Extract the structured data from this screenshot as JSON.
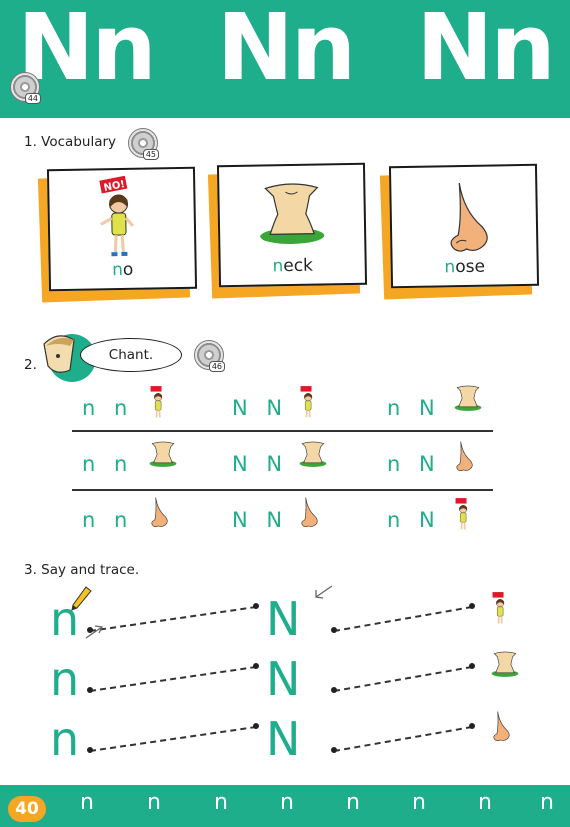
{
  "header": {
    "title": "Nn Nn Nn",
    "track": "44"
  },
  "vocabulary": {
    "title": "1. Vocabulary",
    "track": "45",
    "cards": [
      {
        "first": "n",
        "rest": "o",
        "icon": "girl-no-icon"
      },
      {
        "first": "n",
        "rest": "eck",
        "icon": "neck-icon"
      },
      {
        "first": "n",
        "rest": "ose",
        "icon": "nose-icon"
      }
    ]
  },
  "chant": {
    "number": "2.",
    "bubble": "Chant.",
    "track": "46",
    "rows": [
      [
        {
          "letters": "n n",
          "icon": "girl-no-icon"
        },
        {
          "letters": "N N",
          "icon": "girl-no-icon"
        },
        {
          "letters": "n N",
          "icon": "neck-icon"
        }
      ],
      [
        {
          "letters": "n n",
          "icon": "neck-icon"
        },
        {
          "letters": "N N",
          "icon": "neck-icon"
        },
        {
          "letters": "n N",
          "icon": "nose-icon"
        }
      ],
      [
        {
          "letters": "n n",
          "icon": "nose-icon"
        },
        {
          "letters": "N N",
          "icon": "nose-icon"
        },
        {
          "letters": "n N",
          "icon": "girl-no-icon"
        }
      ]
    ]
  },
  "trace": {
    "title": "3. Say and trace.",
    "rows": [
      {
        "lower": "n",
        "upper": "N",
        "icon": "girl-no-icon"
      },
      {
        "lower": "n",
        "upper": "N",
        "icon": "neck-icon"
      },
      {
        "lower": "n",
        "upper": "N",
        "icon": "nose-icon"
      }
    ]
  },
  "footer": {
    "page_number": "40",
    "letters": [
      "n",
      "n",
      "n",
      "n",
      "n",
      "n",
      "n",
      "n"
    ]
  },
  "colors": {
    "accent": "#1fae8c",
    "orange": "#f5a623"
  }
}
